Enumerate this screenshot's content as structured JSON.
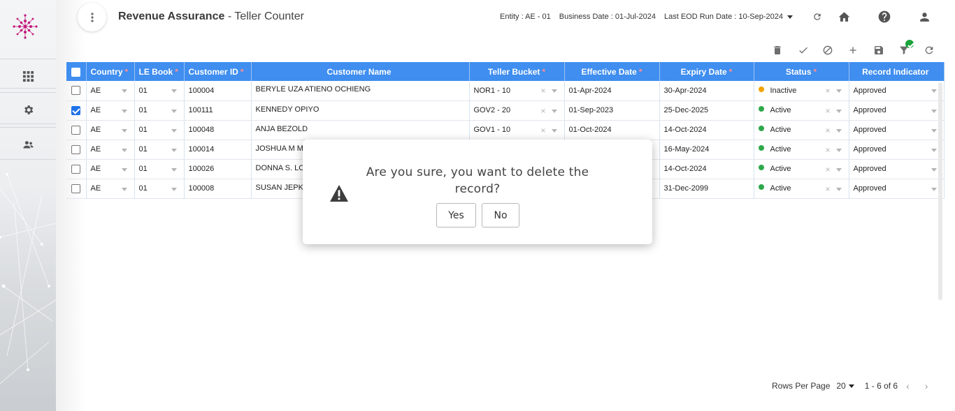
{
  "header": {
    "module": "Revenue Assurance",
    "separator": " - ",
    "screen": "Teller Counter",
    "entity_label": "Entity :",
    "entity_value": "AE - 01",
    "business_date_label": "Business Date :",
    "business_date_value": "01-Jul-2024",
    "eod_label": "Last EOD Run Date :",
    "eod_value": "10-Sep-2024"
  },
  "sidebar": {
    "items": [
      {
        "name": "apps",
        "icon": "grid-icon"
      },
      {
        "name": "settings",
        "icon": "gear-icon"
      },
      {
        "name": "users",
        "icon": "users-icon"
      }
    ]
  },
  "toolbar": {
    "icons": [
      "delete-icon",
      "approve-check-icon",
      "reject-icon",
      "add-icon",
      "save-icon",
      "filter-icon",
      "refresh-icon"
    ]
  },
  "grid": {
    "columns": [
      {
        "label": "Country",
        "required": "*"
      },
      {
        "label": "LE Book",
        "required": "*"
      },
      {
        "label": "Customer ID",
        "required": "*"
      },
      {
        "label": "Customer Name",
        "required": ""
      },
      {
        "label": "Teller Bucket",
        "required": "*"
      },
      {
        "label": "Effective Date",
        "required": "*"
      },
      {
        "label": "Expiry Date",
        "required": "*"
      },
      {
        "label": "Status",
        "required": "*"
      },
      {
        "label": "Record Indicator",
        "required": ""
      }
    ],
    "rows": [
      {
        "checked": false,
        "country": "AE",
        "le_book": "01",
        "customer_id": "100004",
        "customer_name": "BERYLE UZA ATIENO OCHIENG",
        "teller_bucket": "NOR1 - 10",
        "effective_date": "01-Apr-2024",
        "expiry_date": "30-Apr-2024",
        "status": "Inactive",
        "status_color": "#f4a300",
        "record_indicator": "Approved"
      },
      {
        "checked": true,
        "country": "AE",
        "le_book": "01",
        "customer_id": "100111",
        "customer_name": "KENNEDY OPIYO",
        "teller_bucket": "GOV2 - 20",
        "effective_date": "01-Sep-2023",
        "expiry_date": "25-Dec-2025",
        "status": "Active",
        "status_color": "#2ea84a",
        "record_indicator": "Approved"
      },
      {
        "checked": false,
        "country": "AE",
        "le_book": "01",
        "customer_id": "100048",
        "customer_name": "ANJA BEZOLD",
        "teller_bucket": "GOV1 - 10",
        "effective_date": "01-Oct-2024",
        "expiry_date": "14-Oct-2024",
        "status": "Active",
        "status_color": "#2ea84a",
        "record_indicator": "Approved"
      },
      {
        "checked": false,
        "country": "AE",
        "le_book": "01",
        "customer_id": "100014",
        "customer_name": "JOSHUA M M",
        "teller_bucket": "",
        "effective_date": "",
        "expiry_date": "16-May-2024",
        "status": "Active",
        "status_color": "#2ea84a",
        "record_indicator": "Approved"
      },
      {
        "checked": false,
        "country": "AE",
        "le_book": "01",
        "customer_id": "100026",
        "customer_name": "DONNA S. LC",
        "teller_bucket": "",
        "effective_date": "",
        "expiry_date": "14-Oct-2024",
        "status": "Active",
        "status_color": "#2ea84a",
        "record_indicator": "Approved"
      },
      {
        "checked": false,
        "country": "AE",
        "le_book": "01",
        "customer_id": "100008",
        "customer_name": "SUSAN JEPK",
        "teller_bucket": "",
        "effective_date": "",
        "expiry_date": "31-Dec-2099",
        "status": "Active",
        "status_color": "#2ea84a",
        "record_indicator": "Approved"
      }
    ]
  },
  "pager": {
    "rows_per_page_label": "Rows Per Page",
    "rows_per_page_value": "20",
    "range": "1 - 6 of 6"
  },
  "dialog": {
    "message": "Are you sure, you want to delete the record?",
    "yes_label": "Yes",
    "no_label": "No"
  },
  "colors": {
    "header_blue": "#3f8ef0",
    "active_green": "#2ea84a",
    "inactive_orange": "#f4a300",
    "logo_magenta": "#c2187a"
  }
}
